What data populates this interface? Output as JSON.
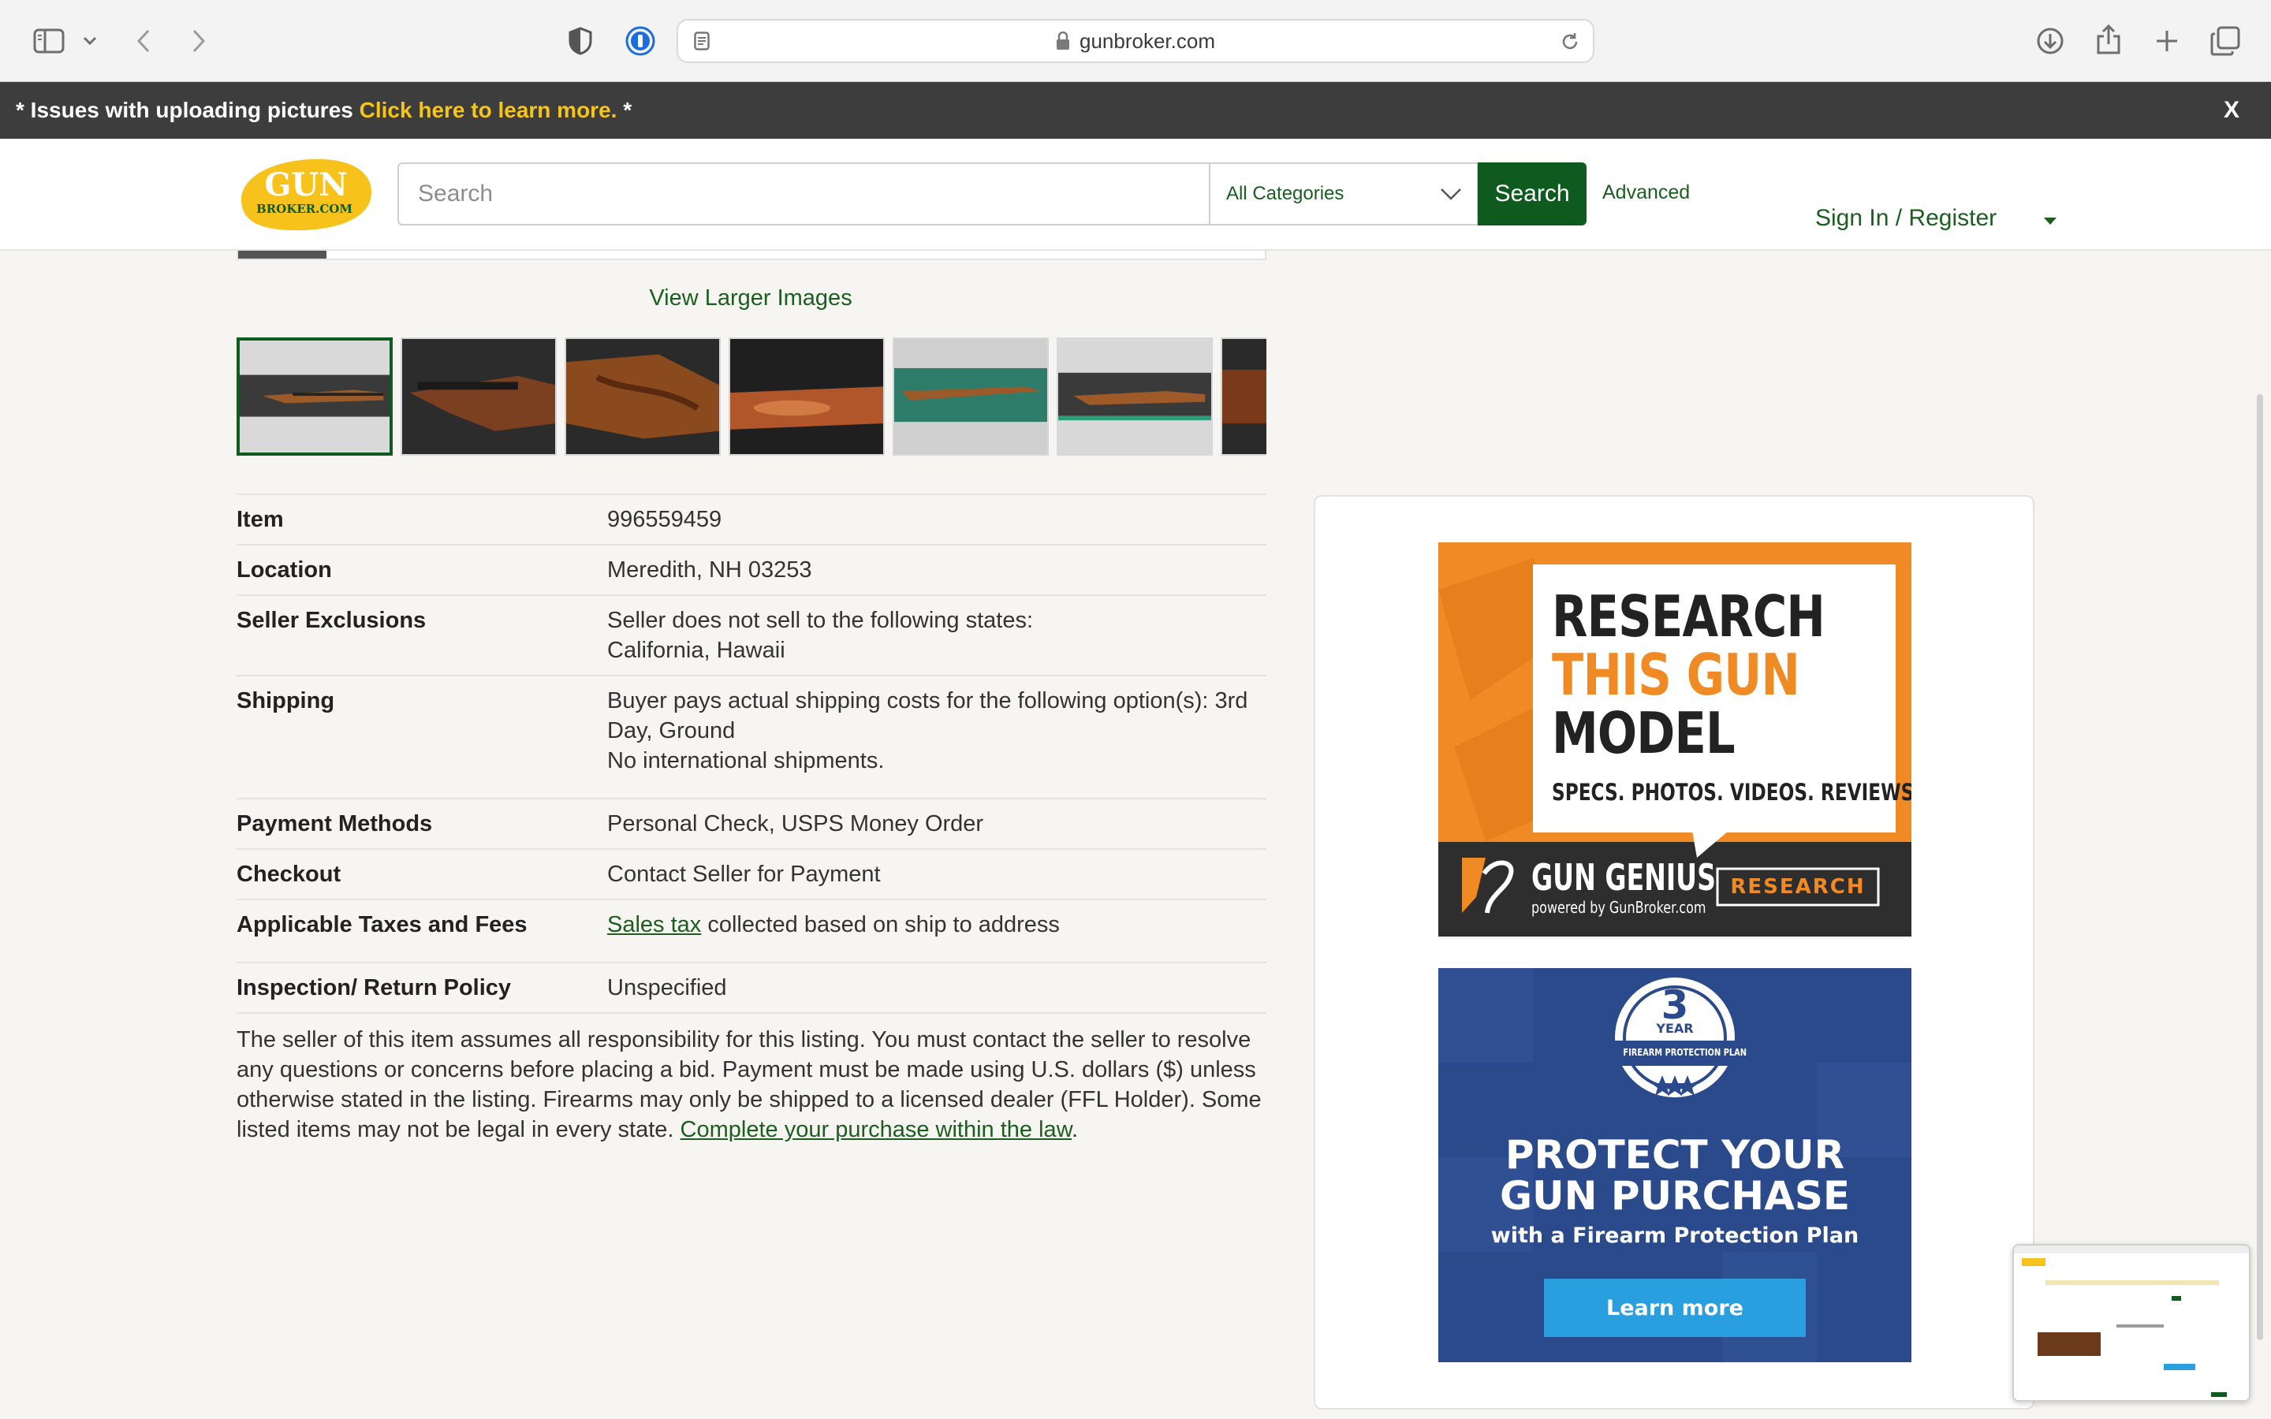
{
  "browser": {
    "url": "gunbroker.com"
  },
  "notice": {
    "prefix": "* Issues with uploading pictures ",
    "link_text": "Click here to learn more.",
    "suffix": " *",
    "close_label": "X"
  },
  "header": {
    "logo_top": "GUN",
    "logo_bottom": "BROKER.COM",
    "search_placeholder": "Search",
    "category_selected": "All Categories",
    "search_button": "Search",
    "advanced_link": "Advanced",
    "sign_in": "Sign In",
    "separator": " / ",
    "register": "Register"
  },
  "gallery": {
    "view_larger": "View Larger Images"
  },
  "details": {
    "item": {
      "label": "Item",
      "value": "996559459"
    },
    "location": {
      "label": "Location",
      "value": "Meredith, NH 03253"
    },
    "seller_exclusions": {
      "label": "Seller Exclusions",
      "line1": "Seller does not sell to the following states:",
      "line2": "California, Hawaii"
    },
    "shipping": {
      "label": "Shipping",
      "line1": "Buyer pays actual shipping costs for the following option(s): 3rd Day, Ground",
      "line2": "No international shipments."
    },
    "payment": {
      "label": "Payment Methods",
      "value": "Personal Check, USPS Money Order"
    },
    "checkout": {
      "label": "Checkout",
      "value": "Contact Seller for Payment"
    },
    "taxes": {
      "label": "Applicable Taxes and Fees",
      "link": "Sales tax",
      "rest": " collected based on ship to address"
    },
    "inspection": {
      "label": "Inspection/ Return Policy",
      "value": "Unspecified"
    }
  },
  "disclaimer": {
    "text": "The seller of this item assumes all responsibility for this listing. You must contact the seller to resolve any questions or concerns before placing a bid. Payment must be made using U.S. dollars ($) unless otherwise stated in the listing. Firearms may only be shipped to a licensed dealer (FFL Holder). Some listed items may not be legal in every state. ",
    "link": "Complete your purchase within the law",
    "end": "."
  },
  "ads": {
    "research": {
      "line1": "RESEARCH",
      "line2": "THIS GUN",
      "line3": "MODEL",
      "tagline": "SPECS. PHOTOS. VIDEOS. REVIEWS.",
      "brand": "GUN GENIUS",
      "powered": "powered by GunBroker.com",
      "button": "RESEARCH"
    },
    "protect": {
      "badge_number": "3",
      "badge_year": "YEAR",
      "badge_plan": "FIREARM PROTECTION PLAN",
      "headline1": "PROTECT YOUR",
      "headline2": "GUN PURCHASE",
      "subline": "with a Firearm Protection Plan",
      "button": "Learn more"
    }
  },
  "colors": {
    "brand_green": "#0f5b1f",
    "link_green": "#1b5e20",
    "notice_bg": "#3d3d3d",
    "notice_link": "#f5c518",
    "logo_yellow": "#f6c21b",
    "ad_orange": "#f08a24",
    "ad_blue": "#2b4a8b"
  }
}
